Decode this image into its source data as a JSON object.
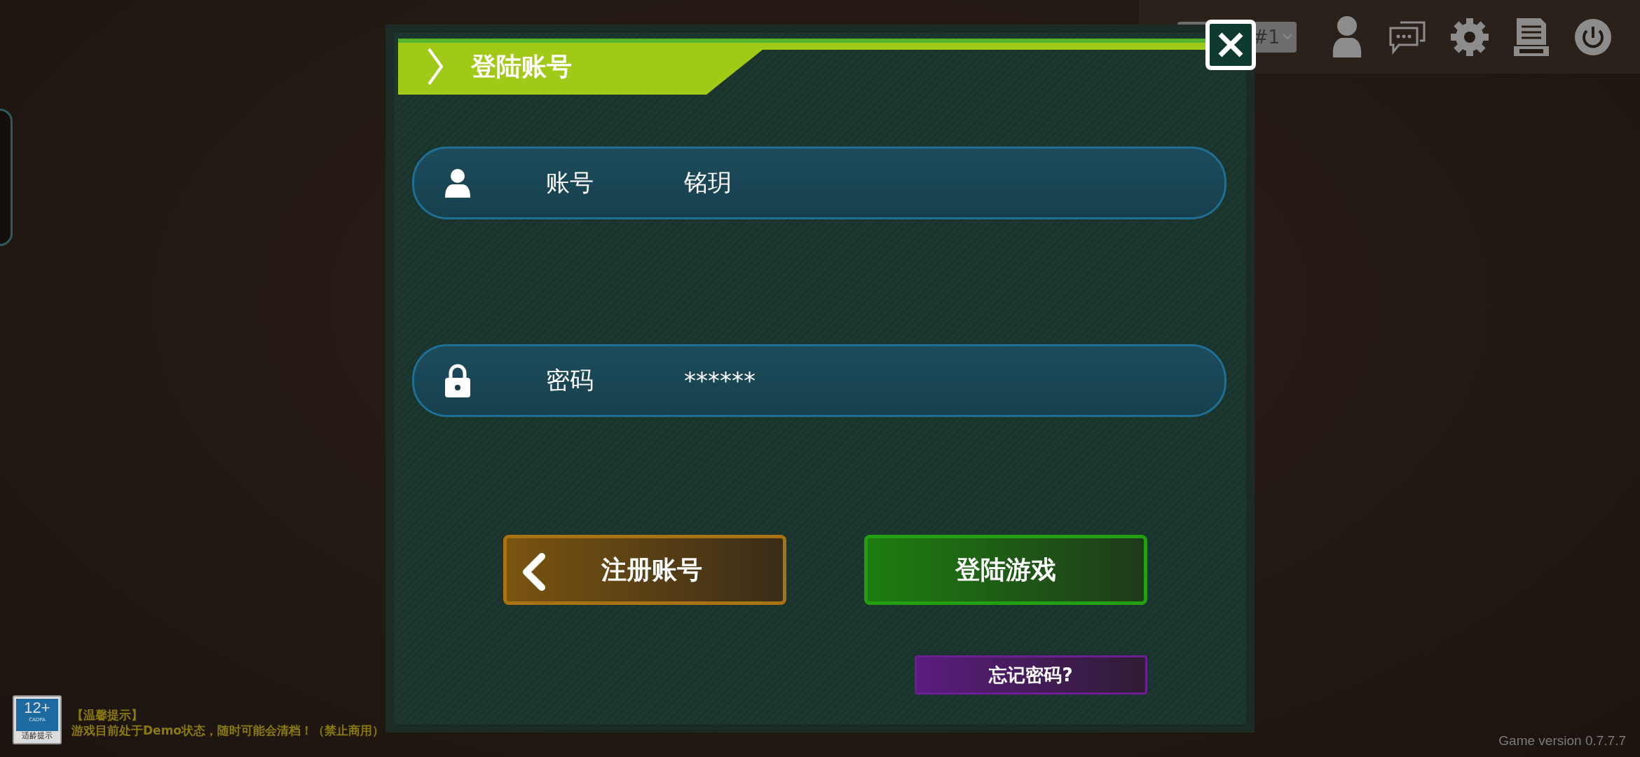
{
  "top_bar": {
    "server_dropdown": {
      "value": "#1"
    }
  },
  "dialog": {
    "title": "登陆账号",
    "fields": [
      {
        "kind": "account",
        "label": "账号",
        "value": "铭玥"
      },
      {
        "kind": "password",
        "label": "密码",
        "value": "******"
      }
    ],
    "buttons": [
      {
        "kind": "back",
        "label": "注册账号"
      },
      {
        "kind": "primary",
        "label": "登陆游戏"
      }
    ],
    "forgot_link": "忘记密码?"
  },
  "age_rating": {
    "age": "12+",
    "org": "CADPA",
    "caption": "适龄提示"
  },
  "notice": {
    "title": "【温馨提示】",
    "text": "游戏目前处于Demo状态，随时可能会清档！（禁止商用）"
  },
  "version": "Game version 0.7.7.7"
}
